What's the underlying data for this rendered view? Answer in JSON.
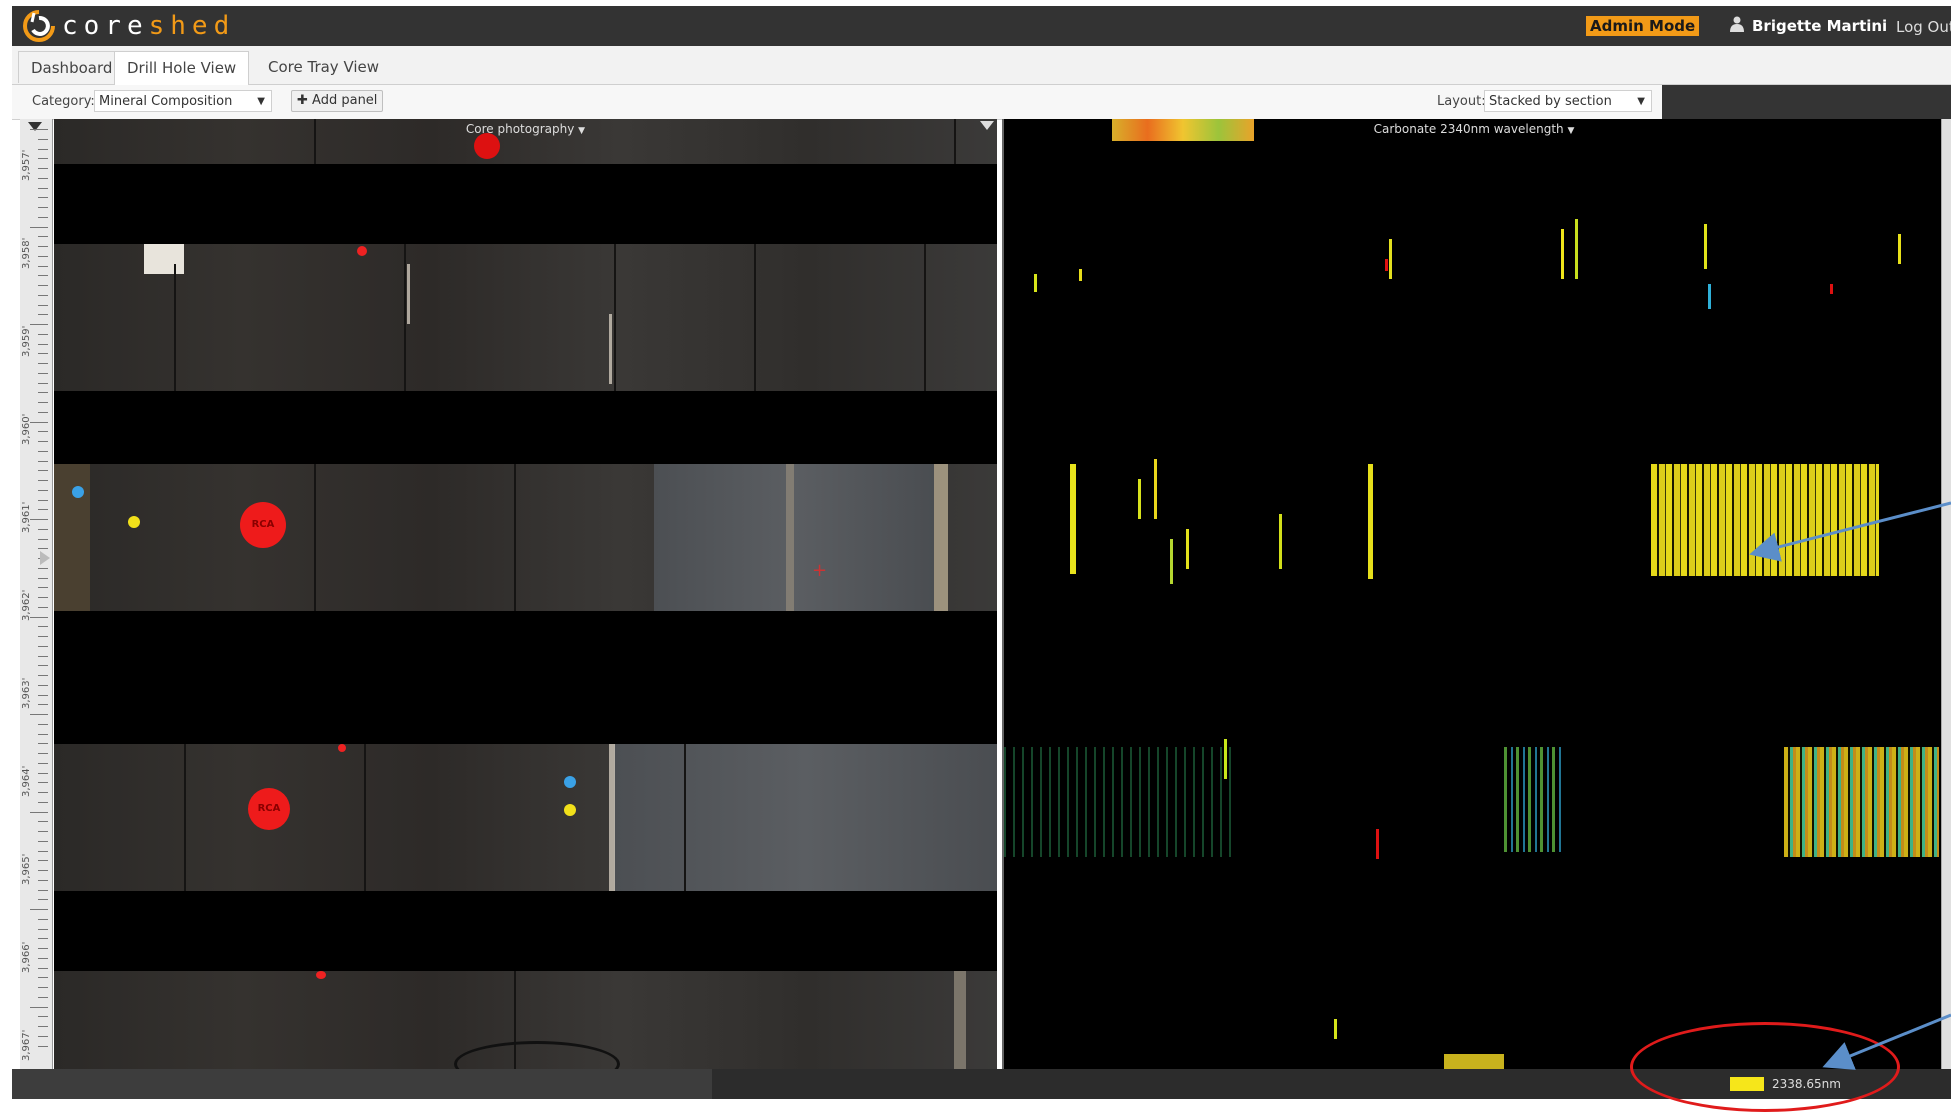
{
  "app": {
    "brand_core": "core",
    "brand_shed": "shed",
    "admin_badge": "Admin Mode",
    "user_name": "Brigette Martini",
    "logout_label": "Log Out"
  },
  "tabs": [
    {
      "label": "Dashboard",
      "active": false
    },
    {
      "label": "Drill Hole View",
      "active": true
    },
    {
      "label": "Core Tray View",
      "active": false
    }
  ],
  "toolbar": {
    "category_label": "Category:",
    "category_value": "Mineral Composition",
    "add_panel_label": "Add panel",
    "layout_label": "Layout:",
    "layout_value": "Stacked by section"
  },
  "panels": {
    "core_title": "Core photography",
    "hyper_title": "Carbonate 2340nm wavelength"
  },
  "depth_labels": [
    "3,957'",
    "3,958'",
    "3,959'",
    "3,960'",
    "3,961'",
    "3,962'",
    "3,963'",
    "3,964'",
    "3,965'",
    "3,966'",
    "3,967'"
  ],
  "markers": {
    "rca_text": "RCA"
  },
  "legend": {
    "value": "2338.65nm",
    "color": "#f6e61a"
  },
  "colors": {
    "topbar": "#333333",
    "accent": "#f29a17",
    "annotation_ring": "#e01b1b",
    "annotation_arrow": "#5b8ec9"
  },
  "icons": {
    "logo": "coreshed-swirl-icon",
    "user": "user-icon",
    "add": "plus-icon",
    "dropdown": "caret-down-icon"
  }
}
